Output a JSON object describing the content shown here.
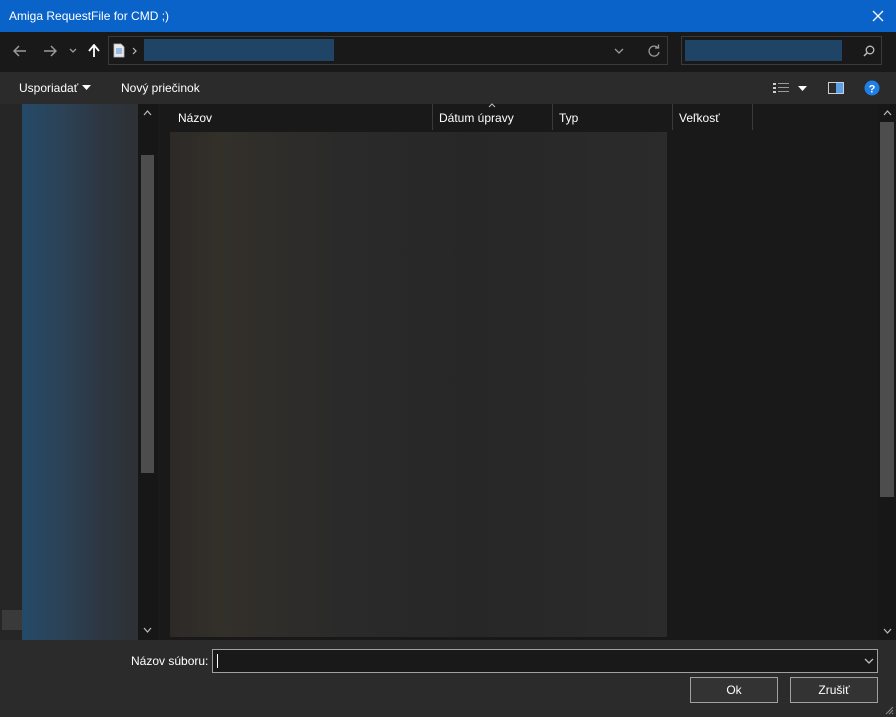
{
  "window": {
    "title": "Amiga RequestFile for CMD ;)"
  },
  "nav": {
    "back_icon": "arrow-left-icon",
    "forward_icon": "arrow-right-icon",
    "recent_icon": "chevron-down-icon",
    "up_icon": "arrow-up-icon",
    "refresh_icon": "refresh-icon",
    "search_icon": "search-icon"
  },
  "toolbar": {
    "organize_label": "Usporiadať",
    "new_folder_label": "Nový priečinok"
  },
  "columns": [
    {
      "label": "Názov"
    },
    {
      "label": "Dátum úpravy"
    },
    {
      "label": "Typ"
    },
    {
      "label": "Veľkosť"
    }
  ],
  "footer": {
    "filename_label": "Názov súboru:",
    "filename_value": "",
    "ok_label": "Ok",
    "cancel_label": "Zrušiť"
  },
  "colors": {
    "titlebar": "#0a63c9",
    "background": "#202020",
    "help": "#1e7fe8"
  }
}
